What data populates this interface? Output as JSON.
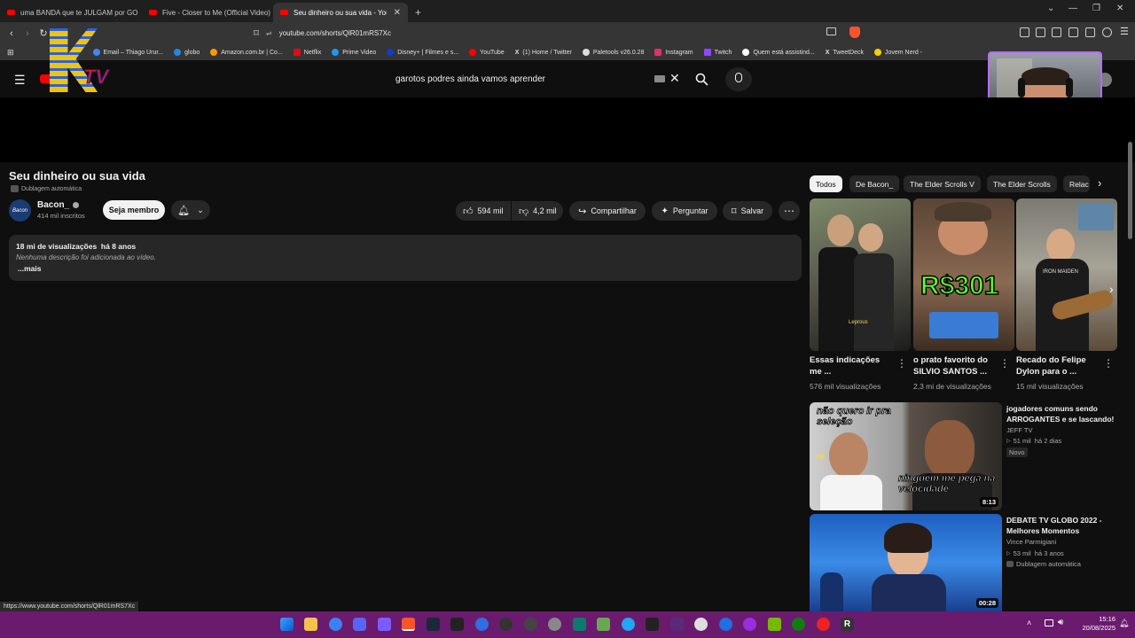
{
  "browser": {
    "tabs": [
      {
        "title": "uma BANDA que te JULGAM por GO"
      },
      {
        "title": "Five - Closer to Me (Official Video)"
      },
      {
        "title": "Seu dinheiro ou sua vida - YouT"
      }
    ],
    "new_tab": "+",
    "url": "youtube.com/shorts/QlR01mRS7Xc",
    "bookmarks": [
      "Email – Thiago Urur...",
      "globo",
      "Amazon.com.br | Co...",
      "Netflix",
      "Prime Video",
      "Disney+ | Filmes e s...",
      "YouTube",
      "(1) Home / Twitter",
      "Paletools v26.0.28",
      "Instagram",
      "Twitch",
      "Quem está assistind...",
      "TweetDeck",
      "Jovem Nerd -"
    ],
    "status_url": "https://www.youtube.com/shorts/QlR01mRS7Xc"
  },
  "overlay": {
    "logo_text": "K",
    "logo_sub": "TV"
  },
  "youtube": {
    "search_query": "garotos podres ainda vamos aprender",
    "video": {
      "title": "Seu dinheiro ou sua vida",
      "dubbing": "Dublagem automática",
      "channel_name": "Bacon_",
      "avatar_text": "Bacon",
      "subscribers": "414 mil inscritos",
      "join_label": "Seja membro",
      "likes": "594 mil",
      "dislikes": "4,2 mil",
      "share": "Compartilhar",
      "ask": "Perguntar",
      "save": "Salvar",
      "views_date": "18 mi de visualizações  há 8 anos",
      "description": "Nenhuma descrição foi adicionada ao vídeo.",
      "more": "...mais"
    },
    "chips": [
      "Todos",
      "De Bacon_",
      "The Elder Scrolls V",
      "The Elder Scrolls",
      "Relac"
    ],
    "shorts": [
      {
        "title": "Essas indicações me ...",
        "views": "576 mil visualizações",
        "thumb_text": "Leprous"
      },
      {
        "title": "o prato favorito do SILVIO SANTOS ...",
        "views": "2,3 mi de visualizações",
        "thumb_text": "R$301"
      },
      {
        "title": "Recado do Felipe Dylon para o ...",
        "views": "15 mil visualizações",
        "thumb_text": "IRON MAIDEN"
      }
    ],
    "videos": [
      {
        "title": "jogadores comuns sendo ARROGANTES e se lascando!",
        "channel": "JEFF TV",
        "meta": "51 mil  há 2 dias",
        "badge": "Novo",
        "duration": "8:13",
        "cap1": "não quero ir pra seleção",
        "cap2": "ninguém me pega na velocidade"
      },
      {
        "title": "DEBATE TV GLOBO 2022 - Melhores Momentos",
        "channel": "Vince Parmigiani",
        "meta": "53 mil  há 3 anos",
        "badge": "Dublagem automática",
        "duration": "00:28"
      }
    ]
  },
  "taskbar": {
    "time": "15:16",
    "date": "20/08/2025"
  }
}
